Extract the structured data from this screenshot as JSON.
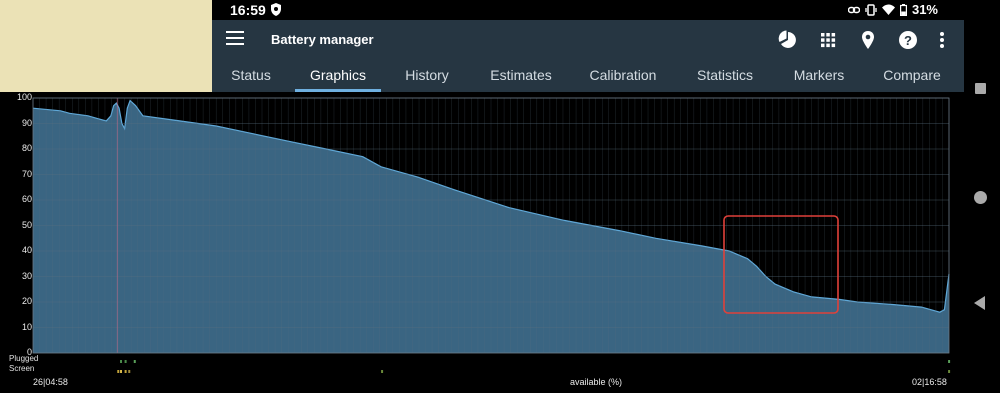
{
  "status_bar": {
    "time": "16:59",
    "battery_percent": "31%"
  },
  "app_bar": {
    "title": "Battery manager",
    "actions": [
      "pie-chart-icon",
      "grid-icon",
      "location-pin-icon",
      "help-icon",
      "overflow-menu-icon"
    ]
  },
  "tabs": [
    {
      "label": "Status",
      "active": false
    },
    {
      "label": "Graphics",
      "active": true
    },
    {
      "label": "History",
      "active": false
    },
    {
      "label": "Estimates",
      "active": false
    },
    {
      "label": "Calibration",
      "active": false
    },
    {
      "label": "Statistics",
      "active": false
    },
    {
      "label": "Markers",
      "active": false
    },
    {
      "label": "Compare",
      "active": false
    }
  ],
  "graph": {
    "row_labels": {
      "plugged": "Plugged",
      "screen": "Screen"
    },
    "start_label": "26|04:58",
    "end_label": "02|16:58",
    "center_label": "available (%)",
    "colors": {
      "fill": "#3a6582",
      "line": "#5fa8d8",
      "grid": "#5a6f80",
      "highlight": "#e0413a"
    }
  },
  "chart_data": {
    "type": "area",
    "y_ticks": [
      0,
      10,
      20,
      30,
      40,
      50,
      60,
      70,
      80,
      90,
      100
    ],
    "ylim": [
      0,
      100
    ],
    "series": [
      {
        "values": [
          [
            0,
            96
          ],
          [
            0.03,
            95
          ],
          [
            0.04,
            94
          ],
          [
            0.06,
            93
          ],
          [
            0.07,
            92
          ],
          [
            0.08,
            91
          ],
          [
            0.085,
            93
          ],
          [
            0.088,
            97
          ],
          [
            0.091,
            98
          ],
          [
            0.094,
            96
          ],
          [
            0.097,
            90
          ],
          [
            0.1,
            88
          ],
          [
            0.103,
            96
          ],
          [
            0.106,
            99
          ],
          [
            0.109,
            98
          ],
          [
            0.112,
            97
          ],
          [
            0.12,
            93
          ],
          [
            0.16,
            91
          ],
          [
            0.2,
            89
          ],
          [
            0.24,
            86
          ],
          [
            0.28,
            83
          ],
          [
            0.32,
            80
          ],
          [
            0.36,
            77
          ],
          [
            0.38,
            73
          ],
          [
            0.42,
            69
          ],
          [
            0.46,
            64
          ],
          [
            0.52,
            57
          ],
          [
            0.58,
            52
          ],
          [
            0.64,
            48
          ],
          [
            0.68,
            45
          ],
          [
            0.73,
            42
          ],
          [
            0.76,
            40
          ],
          [
            0.78,
            37
          ],
          [
            0.79,
            34
          ],
          [
            0.8,
            30
          ],
          [
            0.81,
            27
          ],
          [
            0.83,
            24
          ],
          [
            0.85,
            22
          ],
          [
            0.88,
            21
          ],
          [
            0.9,
            20
          ],
          [
            0.94,
            19
          ],
          [
            0.97,
            18
          ],
          [
            0.99,
            16
          ],
          [
            0.995,
            17
          ],
          [
            1.0,
            31
          ]
        ]
      }
    ]
  }
}
